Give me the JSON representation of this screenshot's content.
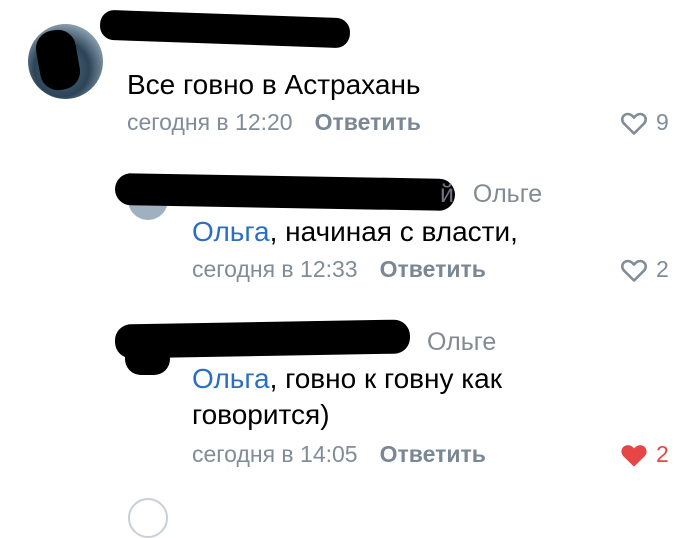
{
  "comments": [
    {
      "author_visible": "",
      "text": "Все говно в Астрахань",
      "time": "сегодня в 12:20",
      "reply_label": "Ответить",
      "likes": "9",
      "liked": false
    },
    {
      "author_visible": "й",
      "reply_to": "Ольге",
      "mention": "Ольга",
      "text_after": ", начиная с власти,",
      "time": "сегодня в 12:33",
      "reply_label": "Ответить",
      "likes": "2",
      "liked": false
    },
    {
      "author_visible": "",
      "reply_to": "Ольге",
      "mention": "Ольга",
      "text_line1": ", говно к говну как",
      "text_line2": "говорится)",
      "time": "сегодня в 14:05",
      "reply_label": "Ответить",
      "likes": "2",
      "liked": true
    }
  ],
  "colors": {
    "mention": "#2a6fc1",
    "meta": "#818c99",
    "like_active": "#e64646"
  }
}
